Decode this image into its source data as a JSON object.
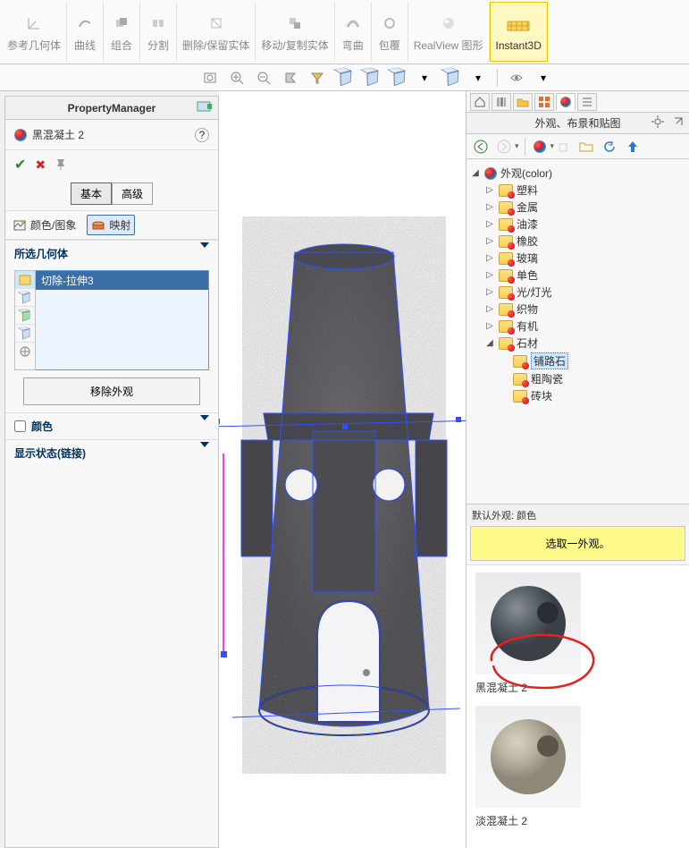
{
  "ribbon": {
    "items": [
      {
        "label": "参考几何体"
      },
      {
        "label": "曲线"
      },
      {
        "label": "组合"
      },
      {
        "label": "分割"
      },
      {
        "label": "删除/保留实体"
      },
      {
        "label": "移动/复制实体"
      },
      {
        "label": "弯曲"
      },
      {
        "label": "包覆"
      },
      {
        "label": "RealView 图形"
      },
      {
        "label": "Instant3D"
      }
    ]
  },
  "pm": {
    "title": "PropertyManager",
    "head": "黑混凝土 2",
    "tabs": {
      "basic": "基本",
      "advanced": "高级"
    },
    "tool_color": "颜色/图象",
    "tool_map": "映射",
    "section_geom": "所选几何体",
    "geom_item": "切除-拉伸3",
    "remove_btn": "移除外观",
    "color_label": "颜色",
    "disp_state": "显示状态(链接)"
  },
  "rp": {
    "title": "外观、布景和贴图",
    "tree": {
      "root": "外观(color)",
      "children": [
        "塑料",
        "金属",
        "油漆",
        "橡胶",
        "玻璃",
        "单色",
        "光/灯光",
        "织物",
        "有机"
      ],
      "stone": "石材",
      "stone_children": [
        "铺路石",
        "粗陶瓷",
        "砖块"
      ]
    },
    "default_label": "默认外观: 颜色",
    "select_hint": "选取一外观。",
    "previews": [
      {
        "label": "黑混凝土 2",
        "tone": "dark"
      },
      {
        "label": "淡混凝土 2",
        "tone": "light"
      }
    ]
  }
}
